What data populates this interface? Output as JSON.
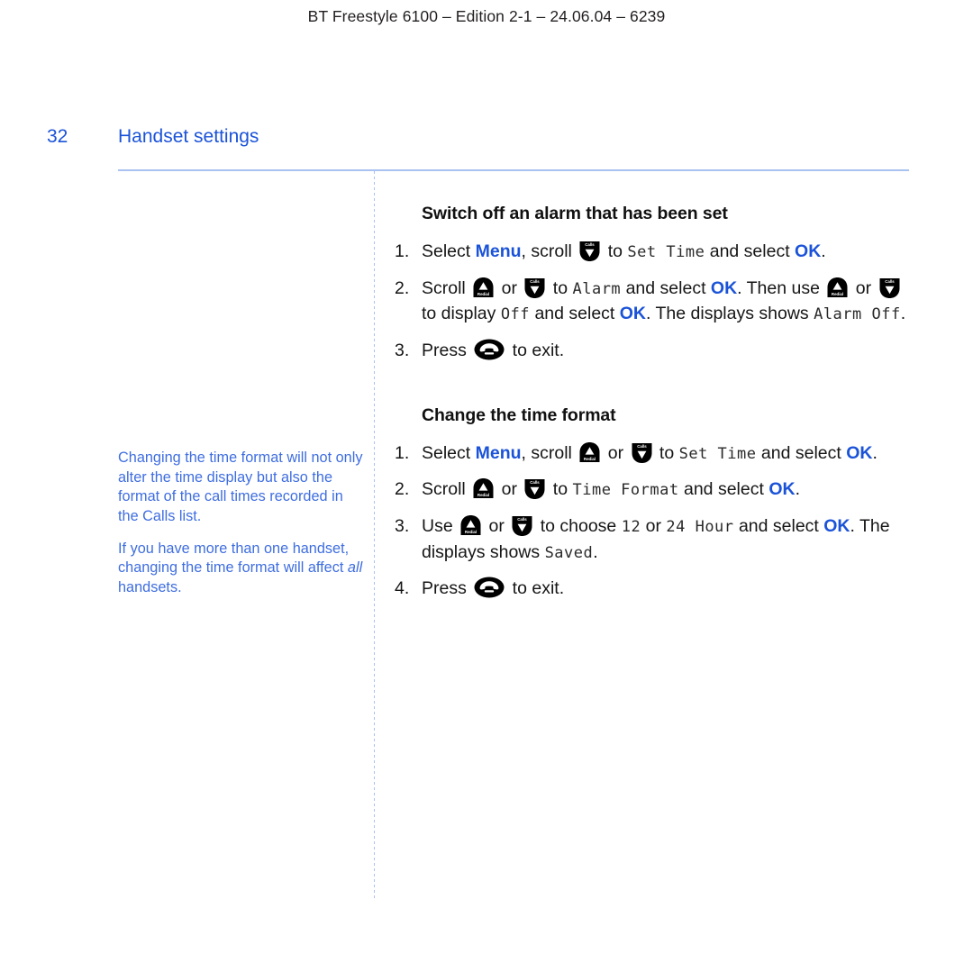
{
  "document": {
    "running_header": "BT Freestyle 6100 – Edition 2-1 – 24.06.04 – 6239",
    "page_number": "32",
    "page_title": "Handset settings"
  },
  "colors": {
    "accent_blue": "#1b53d8",
    "note_blue": "#3f6ee0",
    "rule_blue": "#a9c2f2",
    "body_black": "#161616"
  },
  "notes": {
    "note1": "Changing the time format will not only alter the time display but also the format of the call times recorded in the Calls list.",
    "note2_part1": "If you have more than one handset, changing the time format will affect ",
    "note2_italic": "all",
    "note2_part2": " handsets."
  },
  "icons": {
    "redial_label": "Redial",
    "calls_label": "Calls",
    "up_key_name": "redial-up-key-icon",
    "down_key_name": "calls-down-key-icon",
    "hangup_name": "hangup-key-icon"
  },
  "sections": [
    {
      "heading": "Switch off an alarm that has been set",
      "steps": [
        {
          "num": "1.",
          "parts": [
            {
              "t": "text",
              "v": "Select "
            },
            {
              "t": "kw",
              "v": "Menu"
            },
            {
              "t": "text",
              "v": ", scroll "
            },
            {
              "t": "key",
              "v": "down"
            },
            {
              "t": "text",
              "v": " to "
            },
            {
              "t": "lcd",
              "v": "Set Time"
            },
            {
              "t": "text",
              "v": " and select "
            },
            {
              "t": "kw",
              "v": "OK"
            },
            {
              "t": "text",
              "v": "."
            }
          ]
        },
        {
          "num": "2.",
          "parts": [
            {
              "t": "text",
              "v": "Scroll "
            },
            {
              "t": "key",
              "v": "up"
            },
            {
              "t": "text",
              "v": " or "
            },
            {
              "t": "key",
              "v": "down"
            },
            {
              "t": "text",
              "v": " to "
            },
            {
              "t": "lcd",
              "v": "Alarm"
            },
            {
              "t": "text",
              "v": " and select "
            },
            {
              "t": "kw",
              "v": "OK"
            },
            {
              "t": "text",
              "v": ". Then use "
            },
            {
              "t": "key",
              "v": "up"
            },
            {
              "t": "text",
              "v": " or "
            },
            {
              "t": "key",
              "v": "down"
            },
            {
              "t": "text",
              "v": " to display "
            },
            {
              "t": "lcd",
              "v": "Off"
            },
            {
              "t": "text",
              "v": " and select "
            },
            {
              "t": "kw",
              "v": "OK"
            },
            {
              "t": "text",
              "v": ". The displays shows "
            },
            {
              "t": "lcd",
              "v": "Alarm Off"
            },
            {
              "t": "text",
              "v": "."
            }
          ]
        },
        {
          "num": "3.",
          "parts": [
            {
              "t": "text",
              "v": "Press "
            },
            {
              "t": "key",
              "v": "hangup"
            },
            {
              "t": "text",
              "v": " to exit."
            }
          ]
        }
      ]
    },
    {
      "heading": "Change the time format",
      "steps": [
        {
          "num": "1.",
          "parts": [
            {
              "t": "text",
              "v": "Select "
            },
            {
              "t": "kw",
              "v": "Menu"
            },
            {
              "t": "text",
              "v": ", scroll "
            },
            {
              "t": "key",
              "v": "up"
            },
            {
              "t": "text",
              "v": " or "
            },
            {
              "t": "key",
              "v": "down"
            },
            {
              "t": "text",
              "v": " to "
            },
            {
              "t": "lcd",
              "v": "Set Time"
            },
            {
              "t": "text",
              "v": " and select "
            },
            {
              "t": "kw",
              "v": "OK"
            },
            {
              "t": "text",
              "v": "."
            }
          ]
        },
        {
          "num": "2.",
          "parts": [
            {
              "t": "text",
              "v": "Scroll "
            },
            {
              "t": "key",
              "v": "up"
            },
            {
              "t": "text",
              "v": " or "
            },
            {
              "t": "key",
              "v": "down"
            },
            {
              "t": "text",
              "v": " to "
            },
            {
              "t": "lcd",
              "v": "Time Format"
            },
            {
              "t": "text",
              "v": " and select "
            },
            {
              "t": "kw",
              "v": "OK"
            },
            {
              "t": "text",
              "v": "."
            }
          ]
        },
        {
          "num": "3.",
          "parts": [
            {
              "t": "text",
              "v": "Use "
            },
            {
              "t": "key",
              "v": "up"
            },
            {
              "t": "text",
              "v": " or "
            },
            {
              "t": "key",
              "v": "down"
            },
            {
              "t": "text",
              "v": " to choose "
            },
            {
              "t": "lcd",
              "v": "12"
            },
            {
              "t": "text",
              "v": " or "
            },
            {
              "t": "lcd",
              "v": "24 Hour"
            },
            {
              "t": "text",
              "v": " and select "
            },
            {
              "t": "kw",
              "v": "OK"
            },
            {
              "t": "text",
              "v": ". The displays shows "
            },
            {
              "t": "lcd",
              "v": "Saved"
            },
            {
              "t": "text",
              "v": "."
            }
          ]
        },
        {
          "num": "4.",
          "parts": [
            {
              "t": "text",
              "v": "Press "
            },
            {
              "t": "key",
              "v": "hangup"
            },
            {
              "t": "text",
              "v": " to exit."
            }
          ]
        }
      ]
    }
  ]
}
